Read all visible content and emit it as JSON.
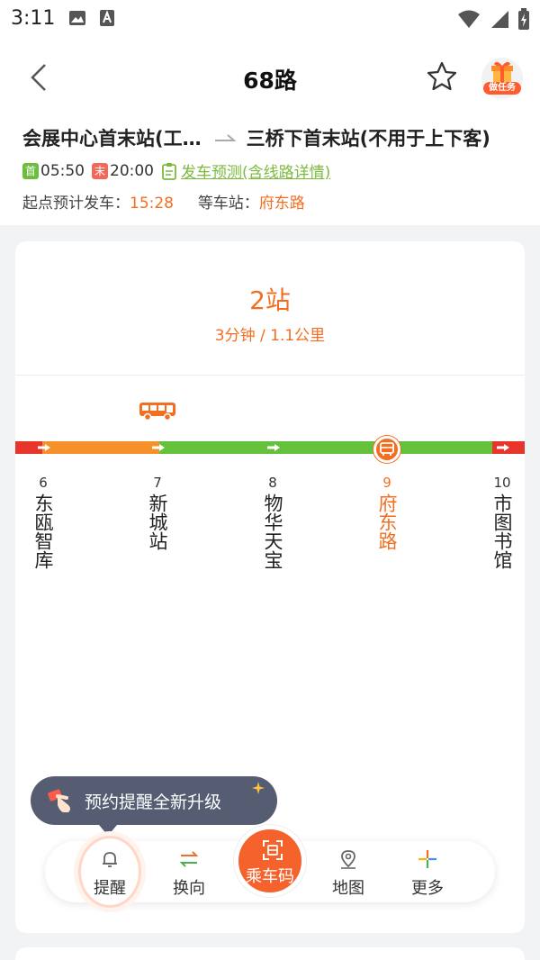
{
  "status_bar": {
    "time": "3:11"
  },
  "header": {
    "title": "68路"
  },
  "task": {
    "label": "做任务"
  },
  "route": {
    "from": "会展中心首末站(工…",
    "to": "三桥下首末站(不用于上下客)",
    "first_tag": "首",
    "first_time": "05:50",
    "last_tag": "末",
    "last_time": "20:00",
    "predict_link": "发车预测(含线路详情)",
    "depart_label": "起点预计发车：",
    "depart_time": "15:28",
    "wait_label": "等车站：",
    "wait_stop": "府东路"
  },
  "arrival": {
    "stops_text": "2站",
    "eta_text": "3分钟 / 1.1公里"
  },
  "stops": [
    {
      "num": "6",
      "name": "东瓯智库"
    },
    {
      "num": "7",
      "name": "新城站"
    },
    {
      "num": "8",
      "name": "物华天宝"
    },
    {
      "num": "9",
      "name": "府东路"
    },
    {
      "num": "10",
      "name": "市图书馆"
    }
  ],
  "tooltip": {
    "text": "预约提醒全新升级"
  },
  "toolbar": {
    "remind": "提醒",
    "reverse": "换向",
    "ride_code": "乘车码",
    "map": "地图",
    "more": "更多"
  },
  "colors": {
    "accent": "#f26f21",
    "road_green": "#63c13b",
    "road_orange": "#f5902a",
    "road_red": "#e8352c"
  }
}
